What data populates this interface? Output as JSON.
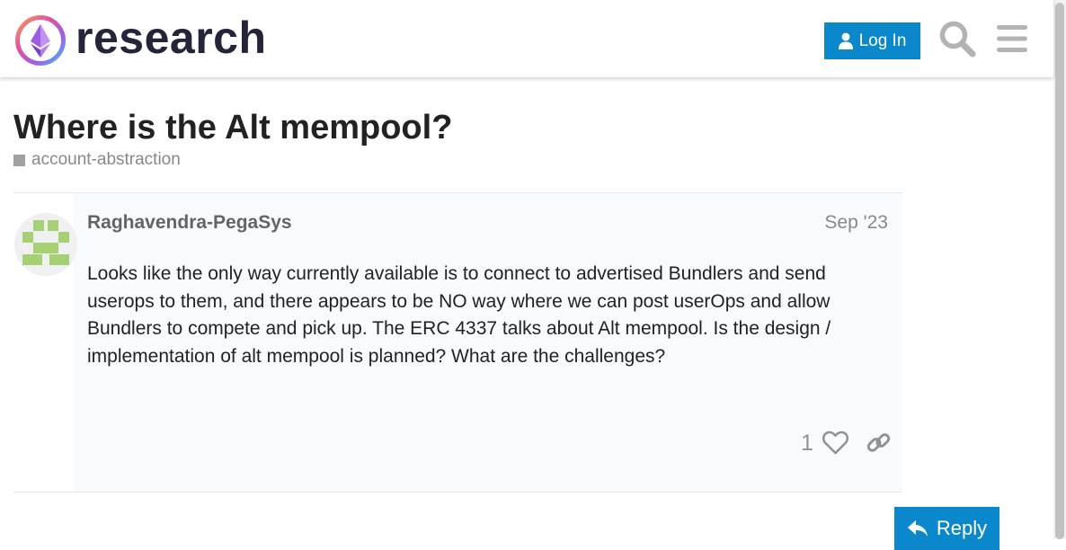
{
  "header": {
    "logo_text": "research",
    "login_label": "Log In"
  },
  "topic": {
    "title": "Where is the Alt mempool?",
    "category": "account-abstraction"
  },
  "post": {
    "author": "Raghavendra-PegaSys",
    "date": "Sep '23",
    "body": "Looks like the only way currently available is to connect to advertised Bundlers and send userops to them, and there appears to be NO way where we can post userOps and allow Bundlers to compete and pick up. The ERC 4337 talks about Alt mempool. Is the design / implementation of alt mempool is planned? What are the challenges?",
    "like_count": "1"
  },
  "actions": {
    "reply_label": "Reply"
  },
  "icons": [
    "ethereum-logo-icon",
    "user-icon",
    "search-icon",
    "hamburger-menu-icon",
    "heart-icon",
    "link-icon",
    "reply-arrow-icon"
  ],
  "colors": {
    "accent": "#0a88cb",
    "logo_text": "#24243a",
    "category_square": "#a0a0a0",
    "avatar_green": "#a6d074"
  }
}
